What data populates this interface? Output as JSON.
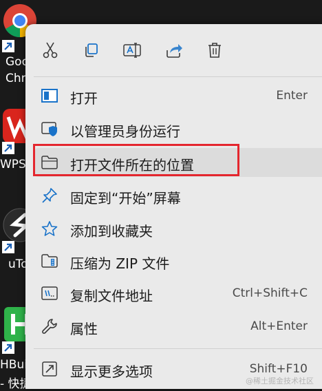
{
  "desktop": {
    "icons": [
      {
        "name": "chrome",
        "label_lines": [
          "Goo",
          "Chro"
        ]
      },
      {
        "name": "wps",
        "label_lines": [
          "WPS"
        ]
      },
      {
        "name": "utools",
        "label_lines": [
          "uTo"
        ]
      },
      {
        "name": "hbuilder",
        "label_lines": [
          "HBuil",
          "- 快捷"
        ]
      }
    ]
  },
  "toolbar": {
    "buttons": [
      {
        "name": "cut",
        "icon": "scissors-icon"
      },
      {
        "name": "copy",
        "icon": "copy-icon"
      },
      {
        "name": "rename",
        "icon": "rename-icon"
      },
      {
        "name": "share",
        "icon": "share-icon"
      },
      {
        "name": "delete",
        "icon": "trash-icon"
      }
    ]
  },
  "menu": {
    "items": [
      {
        "label": "打开",
        "shortcut": "Enter",
        "icon": "app-window-icon"
      },
      {
        "label": "以管理员身份运行",
        "shortcut": "",
        "icon": "shield-icon"
      },
      {
        "label": "打开文件所在的位置",
        "shortcut": "",
        "icon": "folder-icon",
        "highlighted": true
      },
      {
        "label": "固定到“开始”屏幕",
        "shortcut": "",
        "icon": "pin-icon"
      },
      {
        "label": "添加到收藏夹",
        "shortcut": "",
        "icon": "star-icon"
      },
      {
        "label": "压缩为 ZIP 文件",
        "shortcut": "",
        "icon": "zip-folder-icon"
      },
      {
        "label": "复制文件地址",
        "shortcut": "Ctrl+Shift+C",
        "icon": "copy-path-icon"
      },
      {
        "label": "属性",
        "shortcut": "Alt+Enter",
        "icon": "wrench-icon"
      },
      {
        "label": "显示更多选项",
        "shortcut": "Shift+F10",
        "icon": "more-options-icon"
      }
    ]
  },
  "watermark": "@稀土掘金技术社区",
  "colors": {
    "accent_blue": "#1a73c9",
    "highlight_border": "#e4262e",
    "menu_bg": "#eaeaea"
  }
}
